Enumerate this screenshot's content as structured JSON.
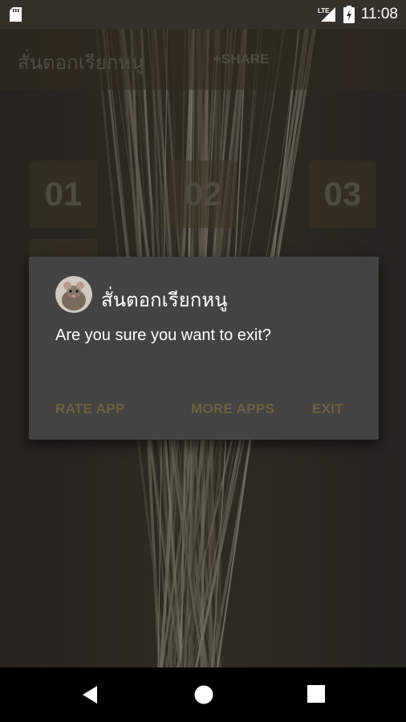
{
  "status_bar": {
    "time": "11:08",
    "network": "LTE",
    "icons": [
      "sd-card-icon",
      "lte-signal-icon",
      "battery-charging-icon"
    ]
  },
  "app_bar": {
    "title": "สั่นตอกเรียกหนู",
    "share_label": "+SHARE"
  },
  "tiles": [
    "01",
    "02",
    "03"
  ],
  "dialog": {
    "title": "สั่นตอกเรียกหนู",
    "icon": "rat-app-icon",
    "message": "Are you sure you want to exit?",
    "buttons": {
      "rate": "RATE APP",
      "more": "MORE APPS",
      "exit": "EXIT"
    }
  },
  "nav_bar": {
    "icons": [
      "back-icon",
      "home-icon",
      "recents-icon"
    ]
  },
  "colors": {
    "dialog_bg": "#434343",
    "button_text": "#6e6142",
    "app_bar": "#4a402e"
  }
}
